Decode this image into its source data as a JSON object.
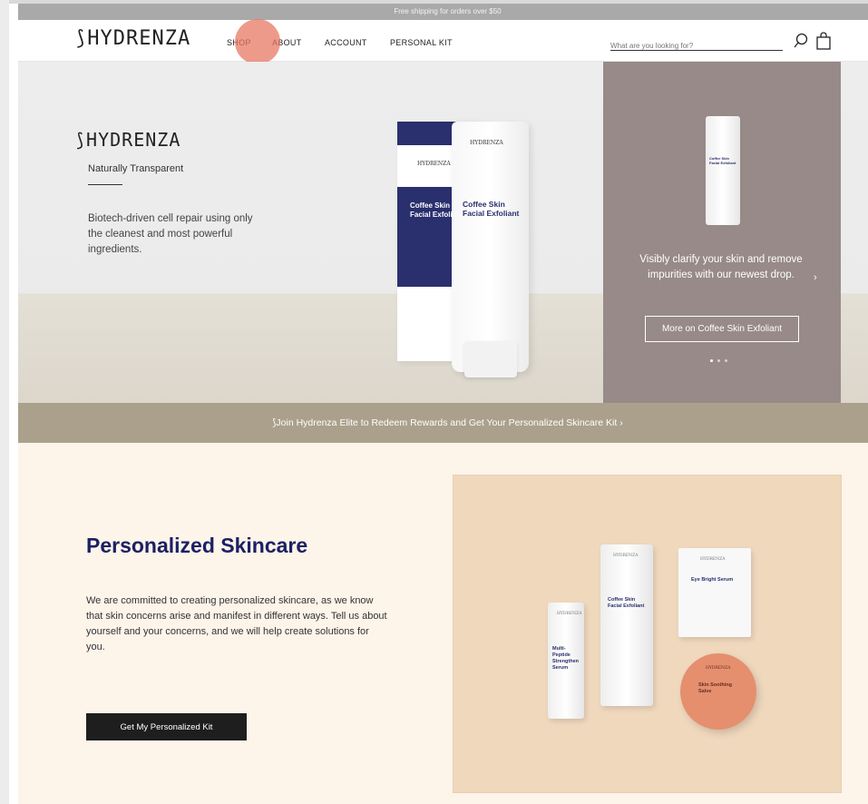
{
  "promo": {
    "text": "Free shipping for orders over $50",
    "close": "×"
  },
  "header": {
    "logo": "HYDRENZA",
    "nav": [
      "SHOP",
      "ABOUT",
      "ACCOUNT",
      "PERSONAL KIT"
    ],
    "search_placeholder": "What are you looking for?"
  },
  "hero": {
    "logo": "HYDRENZA",
    "tagline": "Naturally Transparent",
    "description": "Biotech-driven cell repair using only the cleanest and most powerful ingredients.",
    "product_brand": "HYDRENZA",
    "product_name_1": "Coffee Skin",
    "product_name_2": "Facial Exfoliant"
  },
  "carousel": {
    "text": "Visibly clarify your skin and remove impurities with our newest drop.",
    "button": "More on Coffee Skin Exfoliant",
    "next": "›",
    "slide_count": 3,
    "active_slide": 1
  },
  "elite": {
    "text": "Join Hydrenza Elite to Redeem Rewards and Get Your Personalized Skincare Kit ›"
  },
  "personalized": {
    "title": "Personalized Skincare",
    "description": "We are committed to creating personalized skincare, as we know that skin concerns arise and manifest in different ways. Tell us about yourself and your concerns, and we will help create solutions for you.",
    "button": "Get My Personalized Kit",
    "products": {
      "serum": "Multi-Peptide Strengthen Serum",
      "exfoliant": "Coffee Skin Facial Exfoliant",
      "eye": "Eye Bright Serum",
      "salve": "Skin Soothing Salve",
      "brand": "HYDRENZA"
    }
  },
  "colors": {
    "navy": "#2a2f6e",
    "mauve": "#978a88",
    "banner": "#aaa08c",
    "cream": "#fdf4ea",
    "cursor": "#e87864"
  }
}
